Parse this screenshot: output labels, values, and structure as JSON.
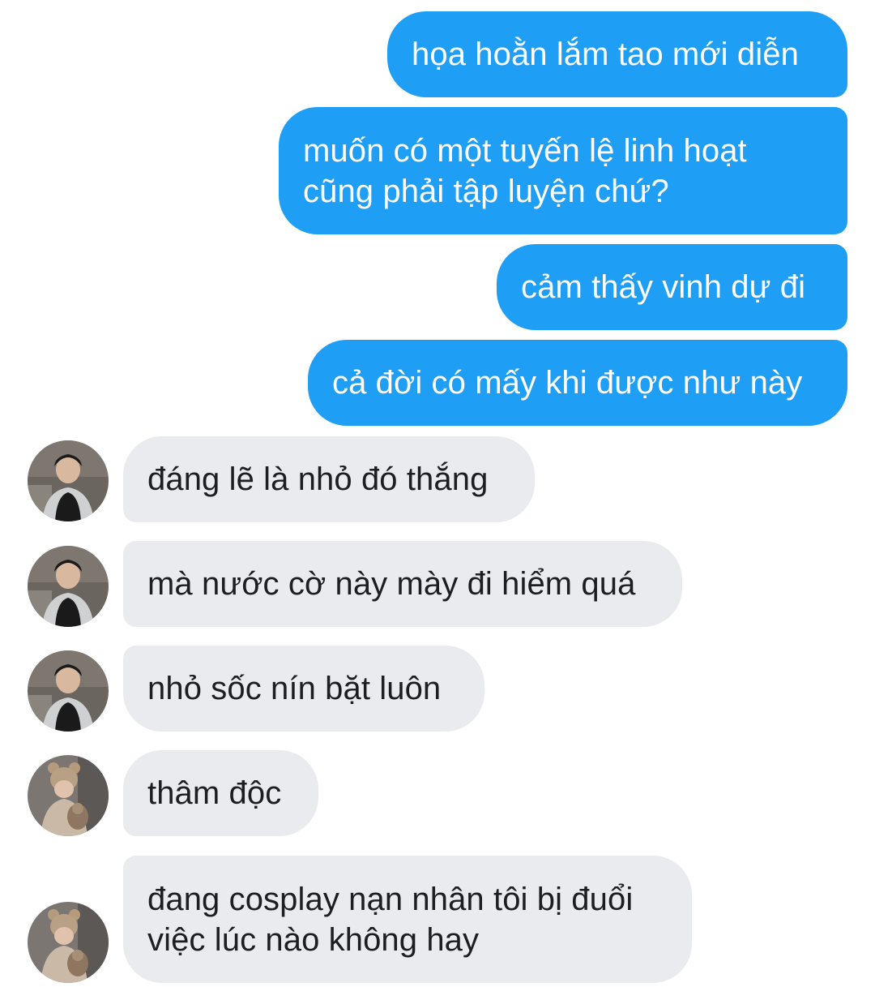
{
  "conversation": {
    "sent_messages": [
      {
        "text": "họa hoằn lắm tao mới diễn"
      },
      {
        "text": "muốn có một tuyến lệ linh hoạt\ncũng phải tập luyện chứ?"
      },
      {
        "text": "cảm thấy vinh dự đi"
      },
      {
        "text": "cả đời có mấy khi được như này"
      }
    ],
    "received_messages": [
      {
        "text": "đáng lẽ là nhỏ đó thắng",
        "avatar": "avatar-boy-photo"
      },
      {
        "text": "mà nước cờ này mày đi hiểm quá",
        "avatar": "avatar-boy-photo"
      },
      {
        "text": "nhỏ sốc nín bặt luôn",
        "avatar": "avatar-boy-photo"
      },
      {
        "text": "thâm độc",
        "avatar": "avatar-bear-hat-photo"
      },
      {
        "text": "đang cosplay nạn nhân tôi bị đuổi\nviệc lúc nào không hay",
        "avatar": "avatar-bear-hat-photo"
      }
    ]
  },
  "colors": {
    "sent_bubble": "#1e9ef4",
    "sent_text": "#ffffff",
    "received_bubble": "#e9ebee",
    "received_text": "#1c1e21"
  }
}
